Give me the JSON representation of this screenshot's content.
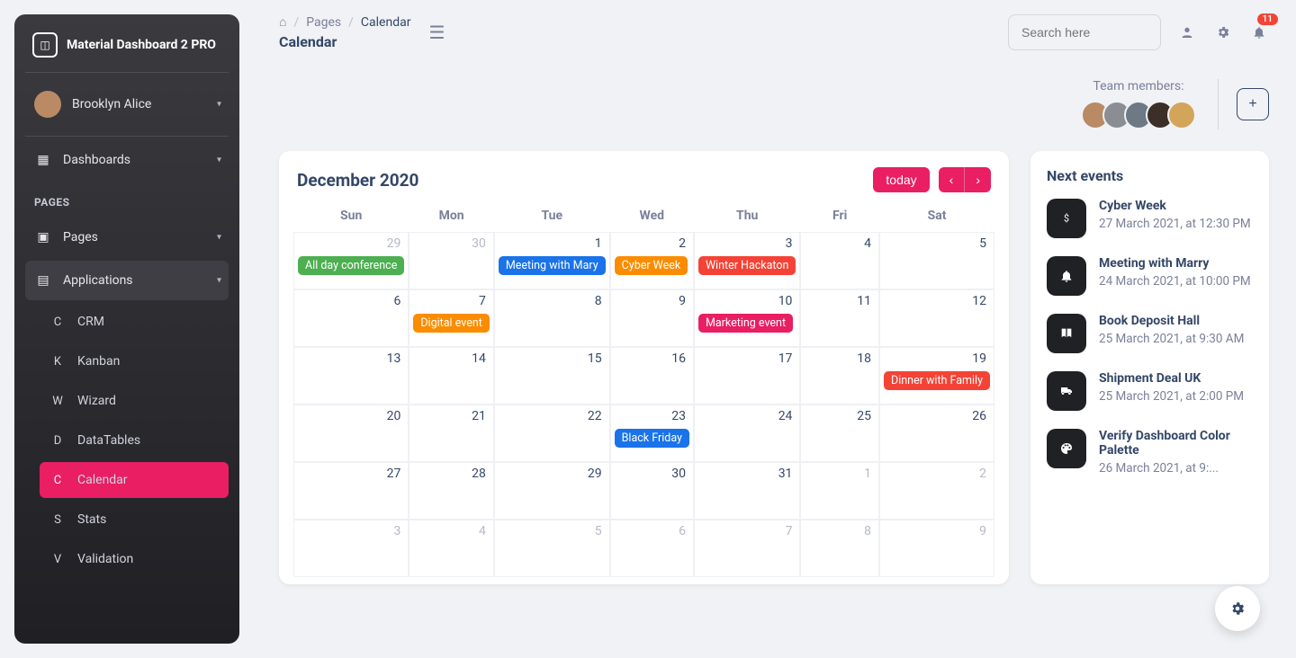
{
  "brand": "Material Dashboard 2 PRO",
  "user_name": "Brooklyn Alice",
  "sidebar": {
    "dashboards": "Dashboards",
    "section_pages": "PAGES",
    "pages": "Pages",
    "applications": "Applications",
    "subs": [
      {
        "abbr": "C",
        "label": "CRM"
      },
      {
        "abbr": "K",
        "label": "Kanban"
      },
      {
        "abbr": "W",
        "label": "Wizard"
      },
      {
        "abbr": "D",
        "label": "DataTables"
      },
      {
        "abbr": "C",
        "label": "Calendar"
      },
      {
        "abbr": "S",
        "label": "Stats"
      },
      {
        "abbr": "V",
        "label": "Validation"
      }
    ]
  },
  "breadcrumbs": {
    "root": "Pages",
    "current": "Calendar",
    "title": "Calendar"
  },
  "search_placeholder": "Search here",
  "notification_count": "11",
  "team_label": "Team members:",
  "avatar_colors": [
    "#b98a64",
    "#8a8d93",
    "#6d7985",
    "#3b2f28",
    "#d2a55a"
  ],
  "calendar": {
    "title": "December 2020",
    "today_label": "today",
    "dows": [
      "Sun",
      "Mon",
      "Tue",
      "Wed",
      "Thu",
      "Fri",
      "Sat"
    ],
    "cells": [
      {
        "n": "29",
        "other": true,
        "ev": {
          "label": "All day conference",
          "cls": "ev-success"
        }
      },
      {
        "n": "30",
        "other": true
      },
      {
        "n": "1",
        "ev": {
          "label": "Meeting with Mary",
          "cls": "ev-info"
        }
      },
      {
        "n": "2",
        "ev": {
          "label": "Cyber Week",
          "cls": "ev-warning"
        }
      },
      {
        "n": "3",
        "ev": {
          "label": "Winter Hackaton",
          "cls": "ev-danger"
        }
      },
      {
        "n": "4"
      },
      {
        "n": "5"
      },
      {
        "n": "6"
      },
      {
        "n": "7",
        "ev": {
          "label": "Digital event",
          "cls": "ev-warning",
          "span": true
        }
      },
      {
        "n": "8"
      },
      {
        "n": "9"
      },
      {
        "n": "10",
        "ev": {
          "label": "Marketing event",
          "cls": "ev-primary"
        }
      },
      {
        "n": "11"
      },
      {
        "n": "12"
      },
      {
        "n": "13"
      },
      {
        "n": "14"
      },
      {
        "n": "15"
      },
      {
        "n": "16"
      },
      {
        "n": "17"
      },
      {
        "n": "18"
      },
      {
        "n": "19",
        "ev": {
          "label": "Dinner with Family",
          "cls": "ev-danger"
        }
      },
      {
        "n": "20"
      },
      {
        "n": "21"
      },
      {
        "n": "22"
      },
      {
        "n": "23",
        "ev": {
          "label": "Black Friday",
          "cls": "ev-info"
        }
      },
      {
        "n": "24"
      },
      {
        "n": "25"
      },
      {
        "n": "26"
      },
      {
        "n": "27"
      },
      {
        "n": "28"
      },
      {
        "n": "29"
      },
      {
        "n": "30"
      },
      {
        "n": "31"
      },
      {
        "n": "1",
        "other": true
      },
      {
        "n": "2",
        "other": true
      },
      {
        "n": "3",
        "other": true
      },
      {
        "n": "4",
        "other": true
      },
      {
        "n": "5",
        "other": true
      },
      {
        "n": "6",
        "other": true
      },
      {
        "n": "7",
        "other": true
      },
      {
        "n": "8",
        "other": true
      },
      {
        "n": "9",
        "other": true
      }
    ]
  },
  "next_events": {
    "title": "Next events",
    "items": [
      {
        "icon": "dollar",
        "name": "Cyber Week",
        "time": "27 March 2021, at 12:30 PM"
      },
      {
        "icon": "bell",
        "name": "Meeting with Marry",
        "time": "24 March 2021, at 10:00 PM"
      },
      {
        "icon": "book",
        "name": "Book Deposit Hall",
        "time": "25 March 2021, at 9:30 AM"
      },
      {
        "icon": "truck",
        "name": "Shipment Deal UK",
        "time": "25 March 2021, at 2:00 PM"
      },
      {
        "icon": "palette",
        "name": "Verify Dashboard Color Palette",
        "time": "26 March 2021, at 9:..."
      }
    ]
  }
}
